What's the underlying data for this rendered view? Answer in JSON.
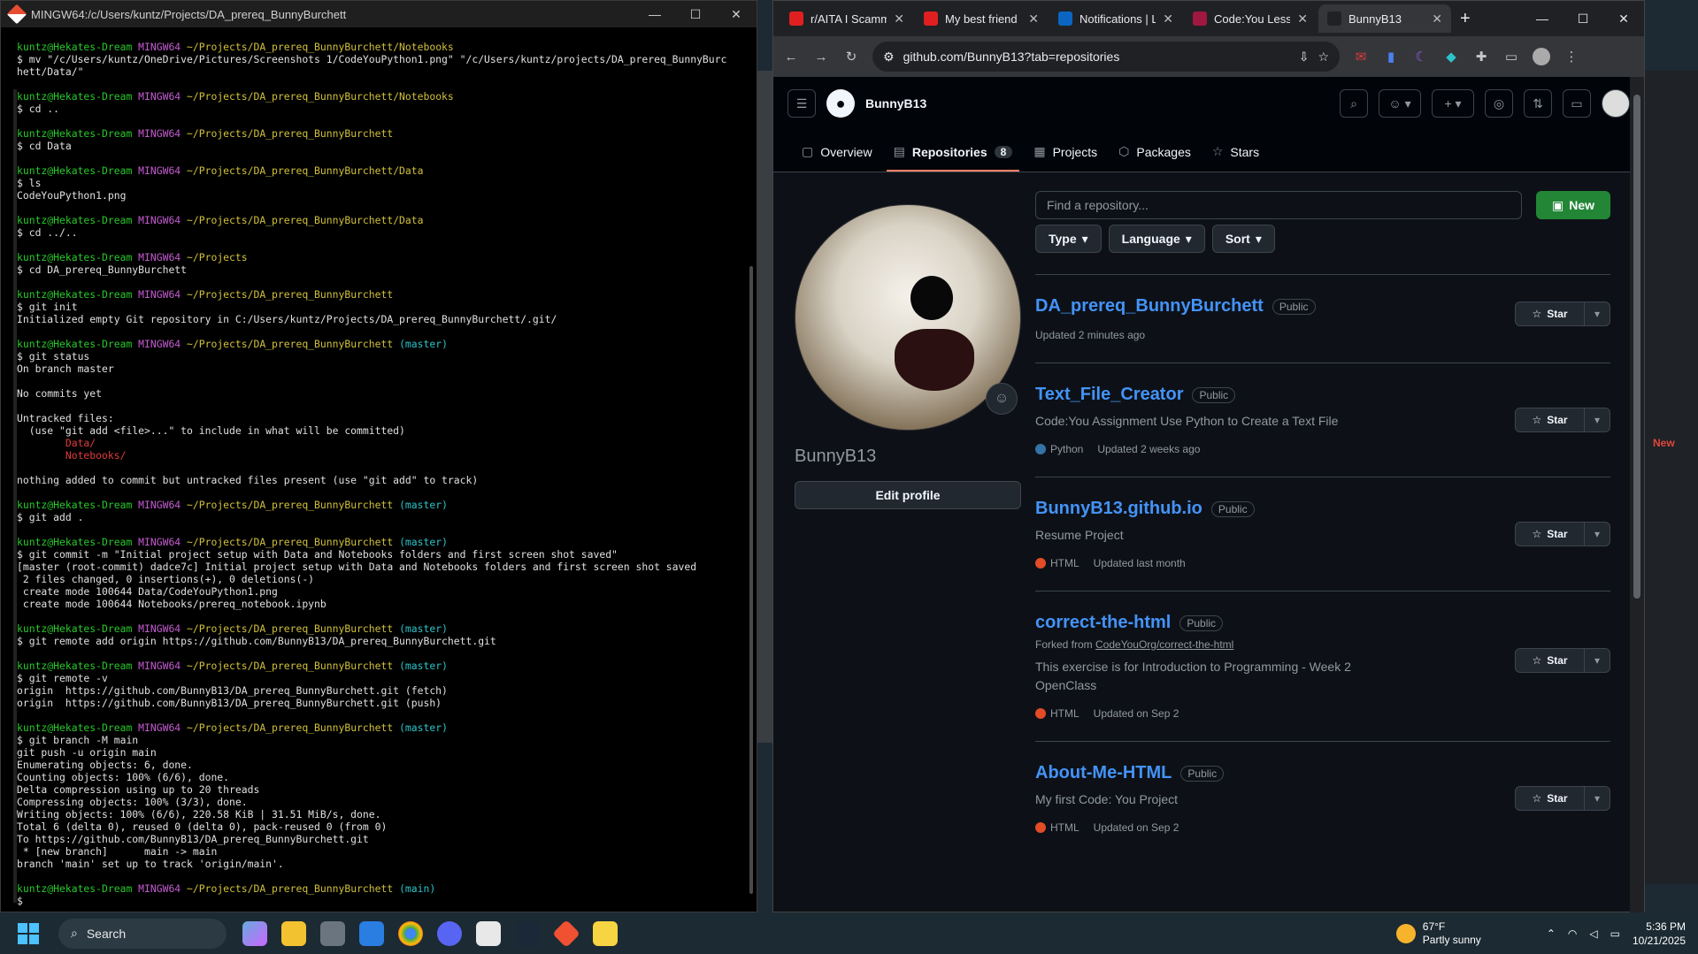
{
  "terminal": {
    "title": "MINGW64:/c/Users/kuntz/Projects/DA_prereq_BunnyBurchett",
    "lines": [
      [
        [
          "g",
          "kuntz@Hekates-Dream "
        ],
        [
          "m",
          "MINGW64 "
        ],
        [
          "y",
          "~/Projects/DA_prereq_BunnyBurchett/Notebooks"
        ]
      ],
      [
        [
          "w",
          "$ mv \"/c/Users/kuntz/OneDrive/Pictures/Screenshots 1/CodeYouPython1.png\" \"/c/Users/kuntz/projects/DA_prereq_BunnyBurc"
        ]
      ],
      [
        [
          "w",
          "hett/Data/\""
        ]
      ],
      [
        [
          "w",
          ""
        ]
      ],
      [
        [
          "g",
          "kuntz@Hekates-Dream "
        ],
        [
          "m",
          "MINGW64 "
        ],
        [
          "y",
          "~/Projects/DA_prereq_BunnyBurchett/Notebooks"
        ]
      ],
      [
        [
          "w",
          "$ cd .."
        ]
      ],
      [
        [
          "w",
          ""
        ]
      ],
      [
        [
          "g",
          "kuntz@Hekates-Dream "
        ],
        [
          "m",
          "MINGW64 "
        ],
        [
          "y",
          "~/Projects/DA_prereq_BunnyBurchett"
        ]
      ],
      [
        [
          "w",
          "$ cd Data"
        ]
      ],
      [
        [
          "w",
          ""
        ]
      ],
      [
        [
          "g",
          "kuntz@Hekates-Dream "
        ],
        [
          "m",
          "MINGW64 "
        ],
        [
          "y",
          "~/Projects/DA_prereq_BunnyBurchett/Data"
        ]
      ],
      [
        [
          "w",
          "$ ls"
        ]
      ],
      [
        [
          "w",
          "CodeYouPython1.png"
        ]
      ],
      [
        [
          "w",
          ""
        ]
      ],
      [
        [
          "g",
          "kuntz@Hekates-Dream "
        ],
        [
          "m",
          "MINGW64 "
        ],
        [
          "y",
          "~/Projects/DA_prereq_BunnyBurchett/Data"
        ]
      ],
      [
        [
          "w",
          "$ cd ../.."
        ]
      ],
      [
        [
          "w",
          ""
        ]
      ],
      [
        [
          "g",
          "kuntz@Hekates-Dream "
        ],
        [
          "m",
          "MINGW64 "
        ],
        [
          "y",
          "~/Projects"
        ]
      ],
      [
        [
          "w",
          "$ cd DA_prereq_BunnyBurchett"
        ]
      ],
      [
        [
          "w",
          ""
        ]
      ],
      [
        [
          "g",
          "kuntz@Hekates-Dream "
        ],
        [
          "m",
          "MINGW64 "
        ],
        [
          "y",
          "~/Projects/DA_prereq_BunnyBurchett"
        ]
      ],
      [
        [
          "w",
          "$ git init"
        ]
      ],
      [
        [
          "w",
          "Initialized empty Git repository in C:/Users/kuntz/Projects/DA_prereq_BunnyBurchett/.git/"
        ]
      ],
      [
        [
          "w",
          ""
        ]
      ],
      [
        [
          "g",
          "kuntz@Hekates-Dream "
        ],
        [
          "m",
          "MINGW64 "
        ],
        [
          "y",
          "~/Projects/DA_prereq_BunnyBurchett "
        ],
        [
          "c",
          "(master)"
        ]
      ],
      [
        [
          "w",
          "$ git status"
        ]
      ],
      [
        [
          "w",
          "On branch master"
        ]
      ],
      [
        [
          "w",
          ""
        ]
      ],
      [
        [
          "w",
          "No commits yet"
        ]
      ],
      [
        [
          "w",
          ""
        ]
      ],
      [
        [
          "w",
          "Untracked files:"
        ]
      ],
      [
        [
          "w",
          "  (use \"git add <file>...\" to include in what will be committed)"
        ]
      ],
      [
        [
          "r",
          "        Data/"
        ]
      ],
      [
        [
          "r",
          "        Notebooks/"
        ]
      ],
      [
        [
          "w",
          ""
        ]
      ],
      [
        [
          "w",
          "nothing added to commit but untracked files present (use \"git add\" to track)"
        ]
      ],
      [
        [
          "w",
          ""
        ]
      ],
      [
        [
          "g",
          "kuntz@Hekates-Dream "
        ],
        [
          "m",
          "MINGW64 "
        ],
        [
          "y",
          "~/Projects/DA_prereq_BunnyBurchett "
        ],
        [
          "c",
          "(master)"
        ]
      ],
      [
        [
          "w",
          "$ git add ."
        ]
      ],
      [
        [
          "w",
          ""
        ]
      ],
      [
        [
          "g",
          "kuntz@Hekates-Dream "
        ],
        [
          "m",
          "MINGW64 "
        ],
        [
          "y",
          "~/Projects/DA_prereq_BunnyBurchett "
        ],
        [
          "c",
          "(master)"
        ]
      ],
      [
        [
          "w",
          "$ git commit -m \"Initial project setup with Data and Notebooks folders and first screen shot saved\""
        ]
      ],
      [
        [
          "w",
          "[master (root-commit) dadce7c] Initial project setup with Data and Notebooks folders and first screen shot saved"
        ]
      ],
      [
        [
          "w",
          " 2 files changed, 0 insertions(+), 0 deletions(-)"
        ]
      ],
      [
        [
          "w",
          " create mode 100644 Data/CodeYouPython1.png"
        ]
      ],
      [
        [
          "w",
          " create mode 100644 Notebooks/prereq_notebook.ipynb"
        ]
      ],
      [
        [
          "w",
          ""
        ]
      ],
      [
        [
          "g",
          "kuntz@Hekates-Dream "
        ],
        [
          "m",
          "MINGW64 "
        ],
        [
          "y",
          "~/Projects/DA_prereq_BunnyBurchett "
        ],
        [
          "c",
          "(master)"
        ]
      ],
      [
        [
          "w",
          "$ git remote add origin https://github.com/BunnyB13/DA_prereq_BunnyBurchett.git"
        ]
      ],
      [
        [
          "w",
          ""
        ]
      ],
      [
        [
          "g",
          "kuntz@Hekates-Dream "
        ],
        [
          "m",
          "MINGW64 "
        ],
        [
          "y",
          "~/Projects/DA_prereq_BunnyBurchett "
        ],
        [
          "c",
          "(master)"
        ]
      ],
      [
        [
          "w",
          "$ git remote -v"
        ]
      ],
      [
        [
          "w",
          "origin  https://github.com/BunnyB13/DA_prereq_BunnyBurchett.git (fetch)"
        ]
      ],
      [
        [
          "w",
          "origin  https://github.com/BunnyB13/DA_prereq_BunnyBurchett.git (push)"
        ]
      ],
      [
        [
          "w",
          ""
        ]
      ],
      [
        [
          "g",
          "kuntz@Hekates-Dream "
        ],
        [
          "m",
          "MINGW64 "
        ],
        [
          "y",
          "~/Projects/DA_prereq_BunnyBurchett "
        ],
        [
          "c",
          "(master)"
        ]
      ],
      [
        [
          "w",
          "$ git branch -M main"
        ]
      ],
      [
        [
          "w",
          "git push -u origin main"
        ]
      ],
      [
        [
          "w",
          "Enumerating objects: 6, done."
        ]
      ],
      [
        [
          "w",
          "Counting objects: 100% (6/6), done."
        ]
      ],
      [
        [
          "w",
          "Delta compression using up to 20 threads"
        ]
      ],
      [
        [
          "w",
          "Compressing objects: 100% (3/3), done."
        ]
      ],
      [
        [
          "w",
          "Writing objects: 100% (6/6), 220.58 KiB | 31.51 MiB/s, done."
        ]
      ],
      [
        [
          "w",
          "Total 6 (delta 0), reused 0 (delta 0), pack-reused 0 (from 0)"
        ]
      ],
      [
        [
          "w",
          "To https://github.com/BunnyB13/DA_prereq_BunnyBurchett.git"
        ]
      ],
      [
        [
          "w",
          " * [new branch]      main -> main"
        ]
      ],
      [
        [
          "w",
          "branch 'main' set up to track 'origin/main'."
        ]
      ],
      [
        [
          "w",
          ""
        ]
      ],
      [
        [
          "g",
          "kuntz@Hekates-Dream "
        ],
        [
          "m",
          "MINGW64 "
        ],
        [
          "y",
          "~/Projects/DA_prereq_BunnyBurchett "
        ],
        [
          "c",
          "(main)"
        ]
      ],
      [
        [
          "w",
          "$ "
        ]
      ]
    ]
  },
  "browser": {
    "tabs": [
      {
        "label": "r/AITA I Scamm",
        "fav": "#e02020"
      },
      {
        "label": "My best friend",
        "fav": "#e02020"
      },
      {
        "label": "Notifications | L",
        "fav": "#0a66c2"
      },
      {
        "label": "Code:You Lesso",
        "fav": "#a01840"
      },
      {
        "label": "BunnyB13",
        "fav": "#202124"
      }
    ],
    "url": "github.com/BunnyB13?tab=repositories"
  },
  "github": {
    "user": "BunnyB13",
    "nav": [
      {
        "icon": "▢",
        "label": "Overview"
      },
      {
        "icon": "▤",
        "label": "Repositories",
        "count": "8"
      },
      {
        "icon": "▦",
        "label": "Projects"
      },
      {
        "icon": "⬡",
        "label": "Packages"
      },
      {
        "icon": "☆",
        "label": "Stars"
      }
    ],
    "username_display": "BunnyB13",
    "edit_profile": "Edit profile",
    "find_placeholder": "Find a repository...",
    "new_label": "New",
    "filters": [
      "Type",
      "Language",
      "Sort"
    ],
    "repos": [
      {
        "name": "DA_prereq_BunnyBurchett",
        "vis": "Public",
        "desc": "",
        "fork": "",
        "lang": "",
        "color": "",
        "updated": "Updated 2 minutes ago"
      },
      {
        "name": "Text_File_Creator",
        "vis": "Public",
        "desc": "Code:You Assignment Use Python to Create a Text File",
        "fork": "",
        "lang": "Python",
        "color": "#3572A5",
        "updated": "Updated 2 weeks ago"
      },
      {
        "name": "BunnyB13.github.io",
        "vis": "Public",
        "desc": "Resume Project",
        "fork": "",
        "lang": "HTML",
        "color": "#e34c26",
        "updated": "Updated last month"
      },
      {
        "name": "correct-the-html",
        "vis": "Public",
        "desc": "This exercise is for Introduction to Programming - Week 2 OpenClass",
        "fork": "CodeYouOrg/correct-the-html",
        "lang": "HTML",
        "color": "#e34c26",
        "updated": "Updated on Sep 2"
      },
      {
        "name": "About-Me-HTML",
        "vis": "Public",
        "desc": "My first Code: You Project",
        "fork": "",
        "lang": "HTML",
        "color": "#e34c26",
        "updated": "Updated on Sep 2"
      }
    ],
    "star_label": "Star",
    "fork_prefix": "Forked from "
  },
  "taskbar": {
    "search": "Search",
    "weather_temp": "67°F",
    "weather_desc": "Partly sunny",
    "time": "5:36 PM",
    "date": "10/21/2025"
  }
}
